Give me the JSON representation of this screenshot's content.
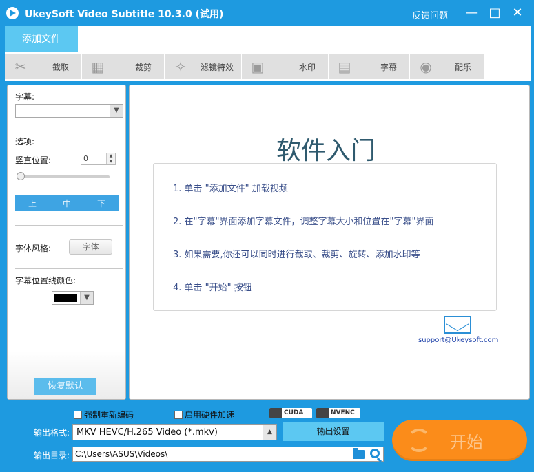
{
  "window": {
    "title": "UkeySoft Video Subtitle 10.3.0 (试用)",
    "feedback": "反馈问题",
    "minimize": "—",
    "maximize": "□",
    "close": "✕"
  },
  "tabs": {
    "add_file": "添加文件"
  },
  "toolbar": {
    "items": [
      {
        "label": "截取",
        "icon": "scissors-icon"
      },
      {
        "label": "裁剪",
        "icon": "crop-icon"
      },
      {
        "label": "滤镜特效",
        "icon": "sparkle-icon"
      },
      {
        "label": "水印",
        "icon": "watermark-icon"
      },
      {
        "label": "字幕",
        "icon": "subtitle-icon"
      },
      {
        "label": "配乐",
        "icon": "music-icon"
      }
    ]
  },
  "left_panel": {
    "subtitle_label": "字幕:",
    "options_label": "选项:",
    "vertical_pos_label": "竖直位置:",
    "vertical_pos_value": "0",
    "align": [
      "上",
      "中",
      "下"
    ],
    "font_style_label": "字体风格:",
    "font_button": "字体",
    "line_color_label": "字幕位置线颜色:",
    "line_color": "#000000",
    "reset_button": "恢复默认"
  },
  "main": {
    "title": "软件入门",
    "steps": [
      "1. 单击 \"添加文件\" 加载视频",
      "2. 在\"字幕\"界面添加字幕文件，调整字幕大小和位置在\"字幕\"界面",
      "3. 如果需要,你还可以同时进行截取、裁剪、旋转、添加水印等",
      "4. 单击 \"开始\" 按钮"
    ],
    "support_email": "support@Ukeysoft.com"
  },
  "bottom": {
    "force_reencode": "强制重新编码",
    "hw_accel": "启用硬件加速",
    "cuda": "CUDA",
    "nvenc": "NVENC",
    "output_format_label": "输出格式:",
    "output_format_value": "MKV HEVC/H.265 Video (*.mkv)",
    "output_settings": "输出设置",
    "output_dir_label": "输出目录:",
    "output_dir_value": "C:\\Users\\ASUS\\Videos\\",
    "start": "开始"
  },
  "colors": {
    "accent": "#1e9ae0",
    "start": "#fb8c1a",
    "tab_active": "#5cc8f2"
  }
}
